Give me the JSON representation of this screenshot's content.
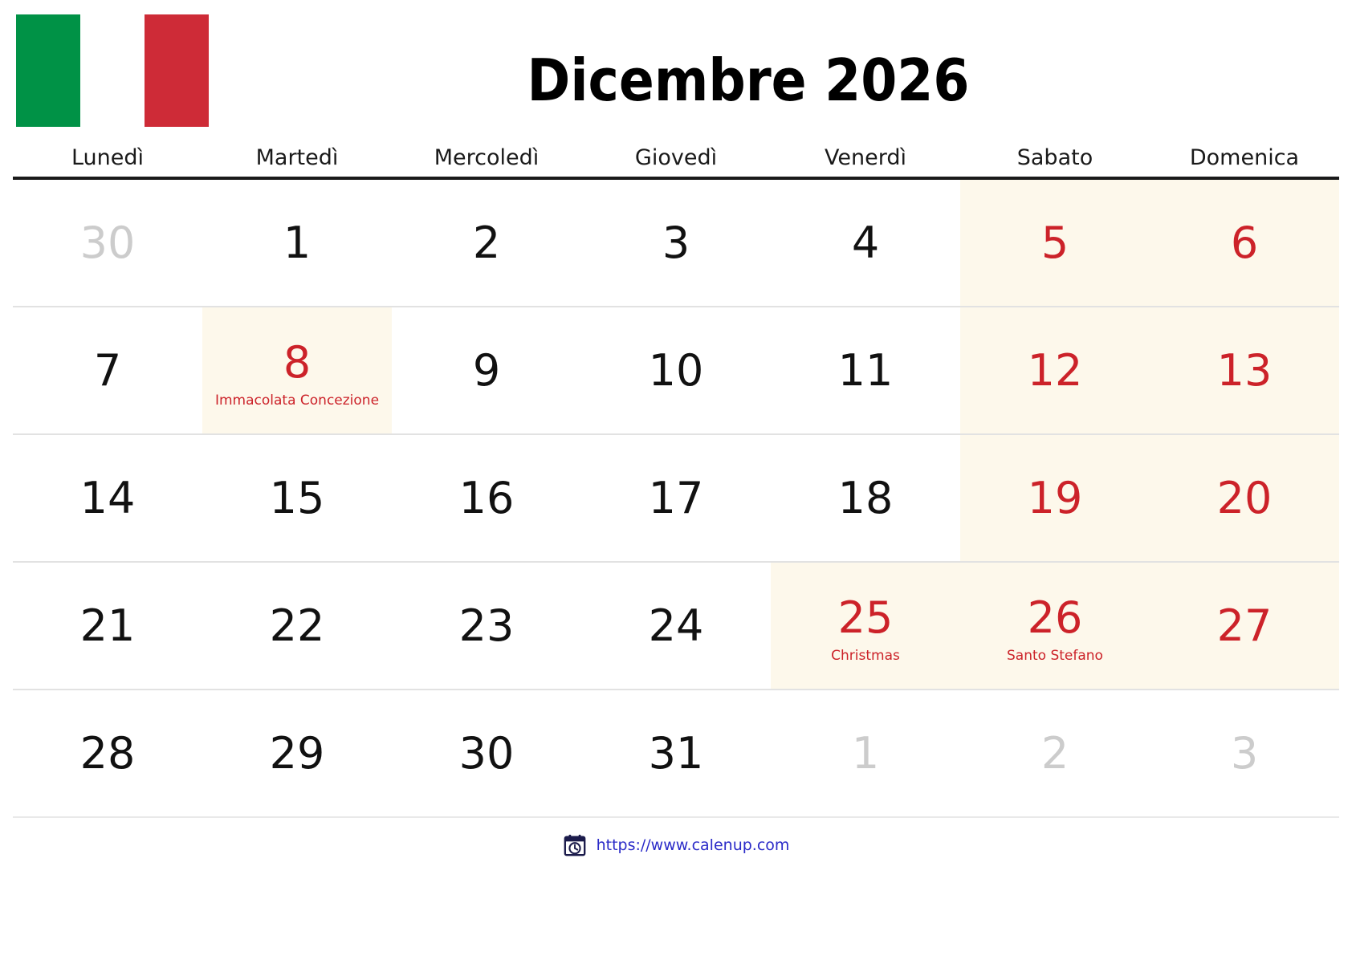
{
  "flag": {
    "alt": "italian-flag",
    "colors": {
      "green": "#009246",
      "white": "#ffffff",
      "red": "#ce2b37"
    }
  },
  "header": {
    "title": "Dicembre 2026",
    "month": "Dicembre",
    "year": "2026"
  },
  "weekdays": [
    "Lunedì",
    "Martedì",
    "Mercoledì",
    "Giovedì",
    "Venerdì",
    "Sabato",
    "Domenica"
  ],
  "colors": {
    "holiday_text": "#cc2229",
    "weekend_bg": "#fdf8eb",
    "muted_text": "#cccccc",
    "day_text": "#111111",
    "link": "#2b2bc8"
  },
  "weeks": [
    {
      "days": [
        {
          "num": "30",
          "type": "muted"
        },
        {
          "num": "1",
          "type": "normal"
        },
        {
          "num": "2",
          "type": "normal"
        },
        {
          "num": "3",
          "type": "normal"
        },
        {
          "num": "4",
          "type": "normal"
        },
        {
          "num": "5",
          "type": "weekend"
        },
        {
          "num": "6",
          "type": "weekend"
        }
      ]
    },
    {
      "days": [
        {
          "num": "7",
          "type": "normal"
        },
        {
          "num": "8",
          "type": "holiday",
          "label": "Immacolata Concezione"
        },
        {
          "num": "9",
          "type": "normal"
        },
        {
          "num": "10",
          "type": "normal"
        },
        {
          "num": "11",
          "type": "normal"
        },
        {
          "num": "12",
          "type": "weekend"
        },
        {
          "num": "13",
          "type": "weekend"
        }
      ]
    },
    {
      "days": [
        {
          "num": "14",
          "type": "normal"
        },
        {
          "num": "15",
          "type": "normal"
        },
        {
          "num": "16",
          "type": "normal"
        },
        {
          "num": "17",
          "type": "normal"
        },
        {
          "num": "18",
          "type": "normal"
        },
        {
          "num": "19",
          "type": "weekend"
        },
        {
          "num": "20",
          "type": "weekend"
        }
      ]
    },
    {
      "days": [
        {
          "num": "21",
          "type": "normal"
        },
        {
          "num": "22",
          "type": "normal"
        },
        {
          "num": "23",
          "type": "normal"
        },
        {
          "num": "24",
          "type": "normal"
        },
        {
          "num": "25",
          "type": "holiday",
          "label": "Christmas"
        },
        {
          "num": "26",
          "type": "holiday",
          "label": "Santo Stefano"
        },
        {
          "num": "27",
          "type": "weekend"
        }
      ]
    },
    {
      "days": [
        {
          "num": "28",
          "type": "normal"
        },
        {
          "num": "29",
          "type": "normal"
        },
        {
          "num": "30",
          "type": "normal"
        },
        {
          "num": "31",
          "type": "normal"
        },
        {
          "num": "1",
          "type": "muted"
        },
        {
          "num": "2",
          "type": "muted"
        },
        {
          "num": "3",
          "type": "muted"
        }
      ]
    }
  ],
  "footer": {
    "icon": "calendar-clock-icon",
    "url": "https://www.calenup.com"
  }
}
